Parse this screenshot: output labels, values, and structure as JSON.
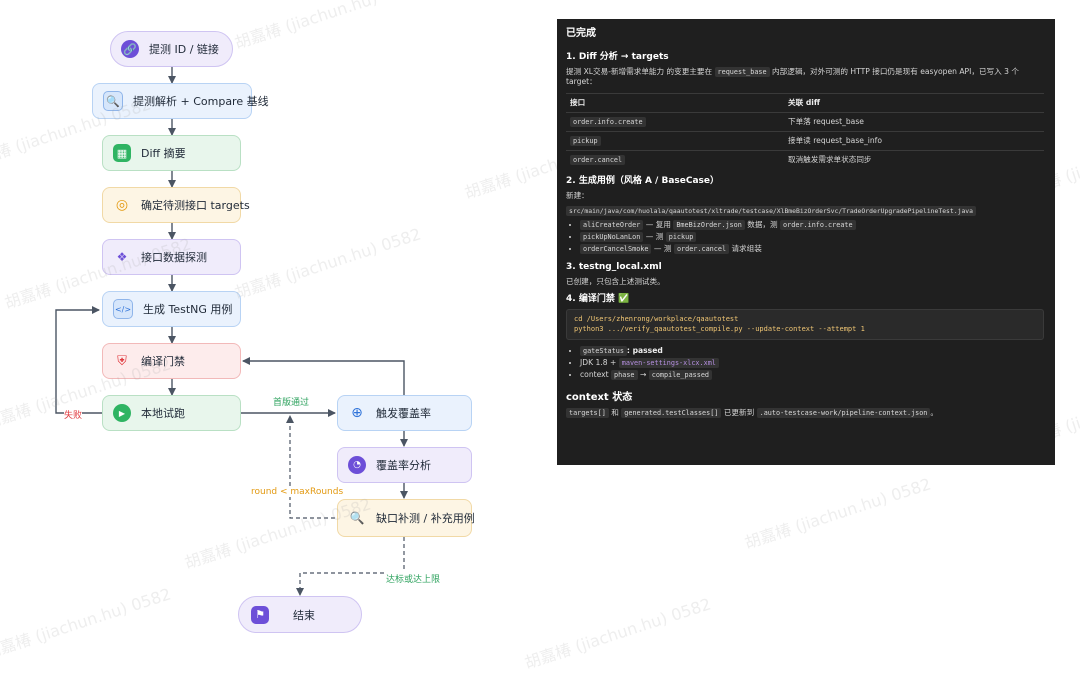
{
  "flow": {
    "nodes": {
      "n1": {
        "label": "提测 ID / 链接",
        "icon": "link-icon"
      },
      "n2": {
        "label": "提测解析 + Compare 基线",
        "icon": "document-search-icon"
      },
      "n3": {
        "label": "Diff 摘要",
        "icon": "bar-chart-icon"
      },
      "n4": {
        "label": "确定待测接口 targets",
        "icon": "target-icon"
      },
      "n5": {
        "label": "接口数据探测",
        "icon": "network-scan-icon"
      },
      "n6": {
        "label": "生成 TestNG 用例",
        "icon": "code-icon"
      },
      "n7": {
        "label": "编译门禁",
        "icon": "shield-icon"
      },
      "n8": {
        "label": "本地试跑",
        "icon": "play-icon"
      },
      "n9": {
        "label": "触发覆盖率",
        "icon": "crosshair-icon"
      },
      "n10": {
        "label": "覆盖率分析",
        "icon": "pie-chart-icon"
      },
      "n11": {
        "label": "缺口补测 / 补充用例",
        "icon": "magnifier-icon"
      },
      "n12": {
        "label": "结束",
        "icon": "finish-flag-icon"
      }
    },
    "edge_labels": {
      "fail": "失败",
      "first_pass": "首版通过",
      "loop": "round < maxRounds",
      "done": "达标或达上限"
    },
    "watermark": "胡嘉椿 (jiachun.hu) 0582"
  },
  "panel": {
    "title": "已完成",
    "s1": {
      "heading": "1. Diff 分析 → targets",
      "intro_a": "提测 XL交易-新增需求单能力 的变更主要在",
      "intro_code": "request_base",
      "intro_b": "内部逻辑，对外可测的 HTTP 接口仍是现有 easyopen API，已写入 3 个 target：",
      "col1": "接口",
      "col2": "关联 diff",
      "rows": [
        {
          "api": "order.info.create",
          "diff": "下单落 request_base"
        },
        {
          "api": "pickup",
          "diff": "接单读 request_base_info"
        },
        {
          "api": "order.cancel",
          "diff": "取消触发需求单状态同步"
        }
      ]
    },
    "s2": {
      "heading": "2. 生成用例（风格 A / BaseCase）",
      "new_label": "新建：",
      "path": "src/main/java/com/huolala/qaautotest/xltrade/testcase/XlBmeBizOrderSvc/TradeOrderUpgradePipelineTest.java",
      "b1_code": "aliCreateOrder",
      "b1_a": "— 复用",
      "b1_code2": "BmeBizOrder.json",
      "b1_b": "数据，测",
      "b1_code3": "order.info.create",
      "b2_code": "pickUpNoLanLon",
      "b2_a": "— 测",
      "b2_code2": "pickup",
      "b3_code": "orderCancelSmoke",
      "b3_a": "— 测",
      "b3_code2": "order.cancel",
      "b3_b": "请求组装"
    },
    "s3": {
      "heading": "3. testng_local.xml",
      "text": "已创建，只包含上述测试类。"
    },
    "s4": {
      "heading": "4. 编译门禁 ✅",
      "cmd1": "cd /Users/zhenrong/workplace/qaautotest",
      "cmd2": "python3 .../verify_qaautotest_compile.py --update-context --attempt 1",
      "b1_code": "gateStatus",
      "b1_text": ": passed",
      "b2_text": "JDK 1.8 +",
      "b2_code": "maven-settings-xlcx.xml",
      "b3_text": "context",
      "b3_code": "phase",
      "b3_arrow": "→",
      "b3_code2": "compile_passed"
    },
    "s5": {
      "heading": "context 状态",
      "code1": "targets[]",
      "and": "和",
      "code2": "generated.testClasses[]",
      "mid": "已更新到",
      "code3": ".auto-testcase-work/pipeline-context.json",
      "end": "。"
    }
  }
}
